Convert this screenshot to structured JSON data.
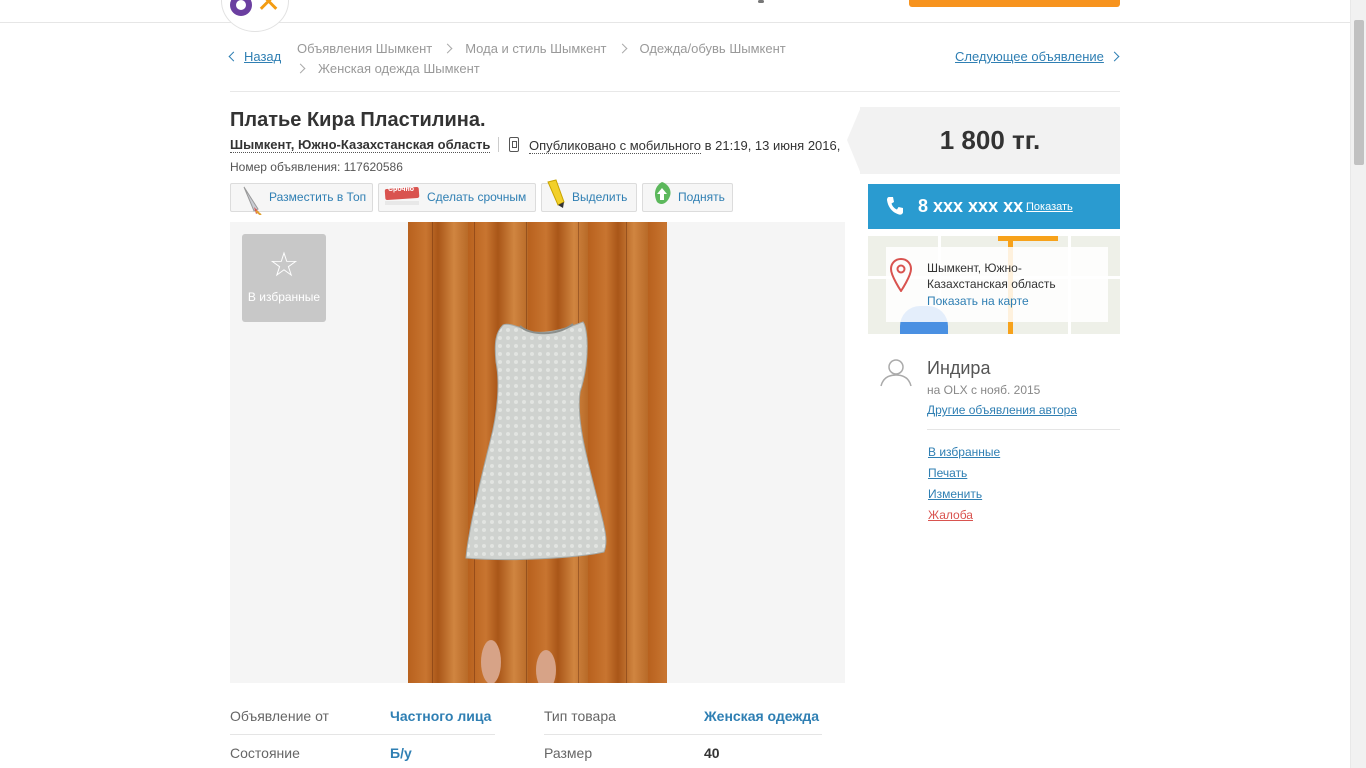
{
  "nav": {
    "back_label": "Назад",
    "breadcrumbs": [
      "Объявления Шымкент",
      "Мода и стиль Шымкент",
      "Одежда/обувь Шымкент",
      "Женская одежда Шымкент"
    ],
    "next_label": "Следующее объявление"
  },
  "ad": {
    "title": "Платье Кира Пластилина.",
    "location": "Шымкент, Южно-Казахстанская область",
    "published_mobile": "Опубликовано с мобильного",
    "published_time": " в 21:19, 13 июня 2016,",
    "number": "Номер объявления: 117620586"
  },
  "promo": {
    "top": "Разместить в Топ",
    "urgent": "Сделать срочным",
    "urgent_badge": "Срочно",
    "highlight": "Выделить",
    "raise": "Поднять"
  },
  "gallery": {
    "favorite_label": "В избранные"
  },
  "params": [
    {
      "label": "Объявление от",
      "value": "Частного лица"
    },
    {
      "label": "Тип товара",
      "value": "Женская одежда"
    },
    {
      "label": "Состояние",
      "value": "Б/у"
    },
    {
      "label": "Размер",
      "value": "40"
    }
  ],
  "sidebar": {
    "price": "1 800 тг.",
    "phone_masked": "8 xxx xxx xx",
    "phone_show": "Показать",
    "map_city": "Шымкент, Южно-Казахстанская область",
    "map_link": "Показать на карте",
    "user_name": "Индира",
    "user_since": "на OLX с нояб. 2015",
    "user_other": "Другие объявления автора",
    "actions": {
      "favorite": "В избранные",
      "print": "Печать",
      "edit": "Изменить",
      "report": "Жалоба"
    }
  },
  "colors": {
    "accent_blue": "#2a9bd0",
    "link_blue": "#2f7fb3",
    "orange": "#f7931e",
    "report_red": "#d9534f"
  }
}
